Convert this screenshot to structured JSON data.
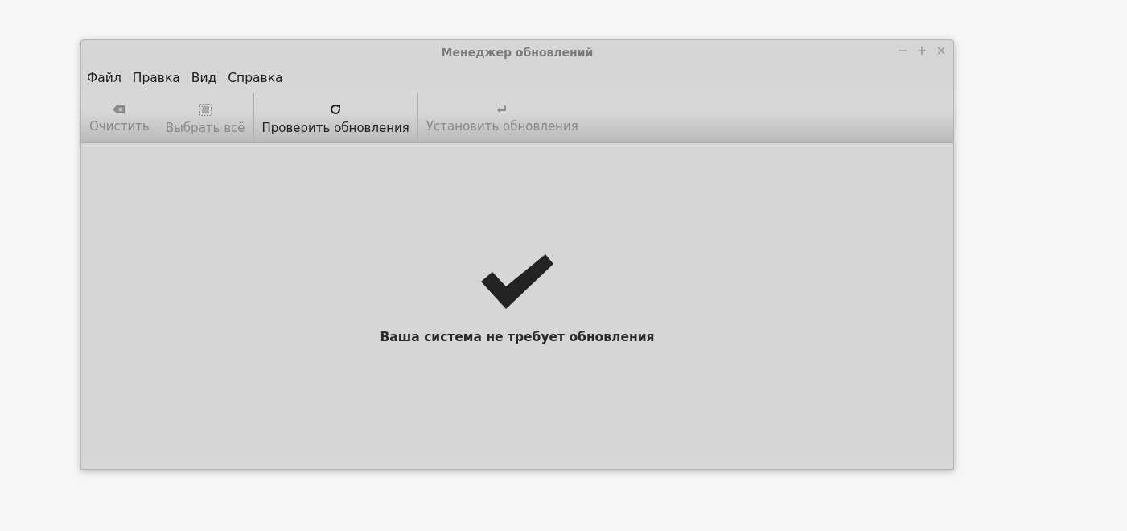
{
  "window": {
    "title": "Менеджер обновлений"
  },
  "menu": [
    "Файл",
    "Правка",
    "Вид",
    "Справка"
  ],
  "toolbar": [
    {
      "label": "Очистить",
      "kind": "clear",
      "disabled": true,
      "separator_before": false
    },
    {
      "label": "Выбрать всё",
      "kind": "select",
      "disabled": true,
      "separator_before": false
    },
    {
      "label": "Проверить обновления",
      "kind": "refresh",
      "disabled": false,
      "separator_before": true
    },
    {
      "label": "Установить обновления",
      "kind": "install",
      "disabled": true,
      "separator_before": true
    }
  ],
  "status": {
    "message": "Ваша система не требует обновления"
  }
}
